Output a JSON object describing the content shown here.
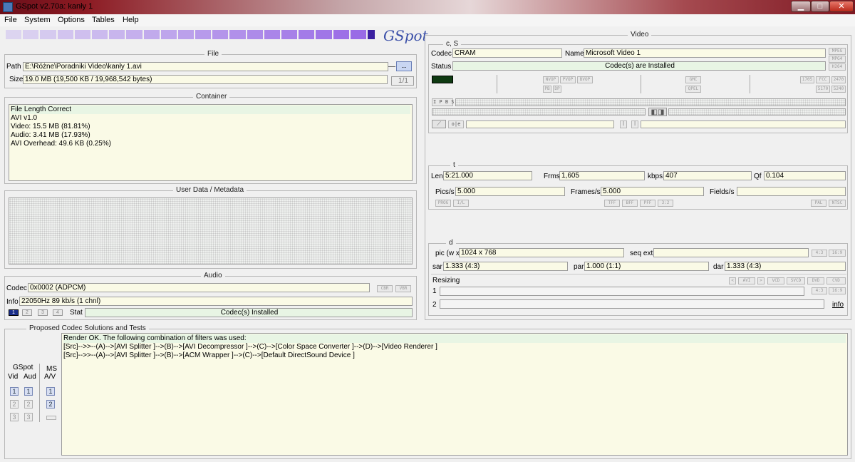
{
  "window": {
    "title": "GSpot v2.70a: kanły 1"
  },
  "menu": [
    "File",
    "System",
    "Options",
    "Tables",
    "Help"
  ],
  "logo": {
    "text": "GSpot"
  },
  "file": {
    "title": "File",
    "path_label": "Path",
    "path_value": "E:\\Różne\\Poradniki Video\\kanły 1.avi",
    "browse_label": "...",
    "size_label": "Size",
    "size_value": "19.0 MB (19,500 KB / 19,968,542 bytes)",
    "page": "1/1"
  },
  "container": {
    "title": "Container",
    "lines": [
      "File Length Correct",
      "AVI v1.0",
      "Video: 15.5 MB (81.81%)",
      "Audio: 3.41 MB (17.93%)",
      "AVI Overhead: 49.6 KB (0.25%)"
    ]
  },
  "metadata": {
    "title": "User Data / Metadata"
  },
  "audio": {
    "title": "Audio",
    "codec_label": "Codec",
    "codec_value": "0x0002 (ADPCM)",
    "cbr": "CBR",
    "vbr": "VBR",
    "info_label": "Info",
    "info_value": "22050Hz  89 kb/s (1 chnl)",
    "stream_buttons": [
      "1",
      "2",
      "3",
      "4"
    ],
    "stat_label": "Stat",
    "stat_value": "Codec(s) Installed"
  },
  "video": {
    "title": "Video",
    "cs_title": "c, S",
    "codec_label": "Codec",
    "codec_value": "CRAM",
    "name_label": "Name",
    "name_value": "Microsoft Video 1",
    "status_label": "Status",
    "status_value": "Codec(s) are Installed",
    "side_tags": [
      "MPEG",
      "MPG4",
      "H264"
    ],
    "flags_a": [
      "NVOP",
      "PVOP",
      "BVOP"
    ],
    "flags_b": [
      "PB",
      "DP"
    ],
    "flags_c": [
      "GMC",
      "QPEL"
    ],
    "flags_d": [
      "1705",
      "FCC",
      "2470"
    ],
    "flags_e": [
      "5170",
      "5240"
    ],
    "ipb": "I P B S",
    "t_title": "t",
    "len_label": "Len",
    "len_value": "5:21.000",
    "frms_label": "Frms",
    "frms_value": "1,605",
    "kbps_label": "kbps",
    "kbps_value": "407",
    "qf_label": "Qf",
    "qf_value": "0.104",
    "pics_label": "Pics/s",
    "pics_value": "5.000",
    "frames_label": "Frames/s",
    "frames_value": "5.000",
    "fields_label": "Fields/s",
    "fields_value": "",
    "scan_tags": [
      "PROG",
      "I/L"
    ],
    "field_tags": [
      "TFF",
      "BFF",
      "PFF",
      "3:2"
    ],
    "std_tags": [
      "PAL",
      "NTSC"
    ],
    "d_title": "d",
    "pic_label": "pic (w x",
    "pic_value": "1024 x 768",
    "seqext_label": "seq ext",
    "sar_label": "sar",
    "sar_value": "1.333 (4:3)",
    "par_label": "par",
    "par_value": "1.000 (1:1)",
    "dar_label": "dar",
    "dar_value": "1.333 (4:3)",
    "aspect_tags": [
      "4:3",
      "16:9"
    ],
    "resizing_label": "Resizing",
    "resize_tags": [
      "<",
      "AVI",
      ">",
      "VCD",
      "SVCD",
      "DVD",
      "CVD"
    ],
    "resize_aspect_tags": [
      "4:3",
      "16:9"
    ],
    "row1": "1",
    "row2": "2",
    "info_link": "info"
  },
  "codecs": {
    "title": "Proposed Codec Solutions and Tests",
    "gspot_label": "GSpot",
    "vid_label": "Vid",
    "aud_label": "Aud",
    "ms_label": "MS",
    "av_label": "A/V",
    "n1": "1",
    "n2": "2",
    "n3": "3",
    "lines": [
      "Render OK. The following combination of filters was used:",
      "[Src]-->>--(A)-->[AVI Splitter ]-->(B)-->[AVI Decompressor ]-->(C)-->[Color Space Converter ]-->(D)-->[Video Renderer ]",
      "[Src]-->>--(A)-->[AVI Splitter ]-->(B)-->[ACM Wrapper ]-->(C)-->[Default DirectSound Device ]"
    ]
  }
}
